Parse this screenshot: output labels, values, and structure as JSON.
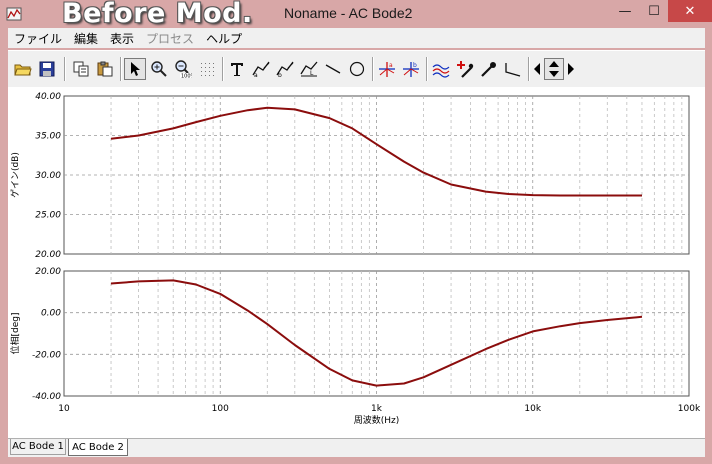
{
  "window": {
    "banner": "Before Mod.",
    "title": "Noname - AC Bode2",
    "min_label": "—",
    "max_label": "☐",
    "close_label": "✕"
  },
  "menu": {
    "items": [
      {
        "label": "ファイル",
        "enabled": true
      },
      {
        "label": "編集",
        "enabled": true
      },
      {
        "label": "表示",
        "enabled": true
      },
      {
        "label": "プロセス",
        "enabled": false
      },
      {
        "label": "ヘルプ",
        "enabled": true
      }
    ]
  },
  "toolbar": {
    "buttons": [
      "open-folder-icon",
      "save-icon",
      "copy-icon",
      "paste-icon",
      "pointer-icon",
      "zoom-in-icon",
      "zoom-100-icon",
      "grid-icon",
      "text-tool-icon",
      "cursor-a-icon",
      "cursor-b-icon",
      "label-icon",
      "line-tool-icon",
      "ellipse-tool-icon",
      "cursor-a-marker-icon",
      "cursor-b-marker-icon",
      "multi-trace-icon",
      "add-marker-icon",
      "probe-icon",
      "slope-icon",
      "arrow-left-icon",
      "arrow-updown-icon",
      "arrow-right-icon"
    ]
  },
  "tabs": [
    {
      "label": "AC Bode 1",
      "active": false
    },
    {
      "label": "AC Bode 2",
      "active": true
    }
  ],
  "chart_data": [
    {
      "type": "line",
      "ylabel": "ゲイン(dB)",
      "xlabel": "",
      "xscale": "log",
      "xlim": [
        10,
        100000
      ],
      "ylim": [
        20,
        40
      ],
      "yticks": [
        "40.00",
        "35.00",
        "30.00",
        "25.00",
        "20.00"
      ],
      "grid": true,
      "series": [
        {
          "color": "#8b0d0d",
          "x": [
            20,
            30,
            50,
            70,
            100,
            150,
            200,
            300,
            500,
            700,
            1000,
            1500,
            2000,
            3000,
            5000,
            7000,
            10000,
            15000,
            20000,
            30000,
            50000
          ],
          "y": [
            34.6,
            35.0,
            35.9,
            36.7,
            37.5,
            38.2,
            38.5,
            38.3,
            37.2,
            35.9,
            33.9,
            31.7,
            30.3,
            28.8,
            27.9,
            27.6,
            27.45,
            27.4,
            27.4,
            27.4,
            27.4
          ]
        }
      ]
    },
    {
      "type": "line",
      "ylabel": "位相[deg]",
      "xlabel": "周波数(Hz)",
      "xscale": "log",
      "xlim": [
        10,
        100000
      ],
      "ylim": [
        -40,
        20
      ],
      "yticks": [
        "20.00",
        "0.00",
        "-20.00",
        "-40.00"
      ],
      "xticks": [
        "10",
        "100",
        "1k",
        "10k",
        "100k"
      ],
      "grid": true,
      "series": [
        {
          "color": "#8b0d0d",
          "x": [
            20,
            30,
            50,
            70,
            100,
            150,
            200,
            300,
            500,
            700,
            1000,
            1500,
            2000,
            3000,
            5000,
            7000,
            10000,
            15000,
            20000,
            30000,
            50000
          ],
          "y": [
            14.0,
            15.0,
            15.5,
            13.5,
            9.0,
            1.0,
            -5.5,
            -15.5,
            -27.0,
            -32.5,
            -35.0,
            -34.0,
            -31.0,
            -25.0,
            -17.5,
            -13.0,
            -9.0,
            -6.5,
            -5.0,
            -3.5,
            -2.0
          ]
        }
      ]
    }
  ]
}
